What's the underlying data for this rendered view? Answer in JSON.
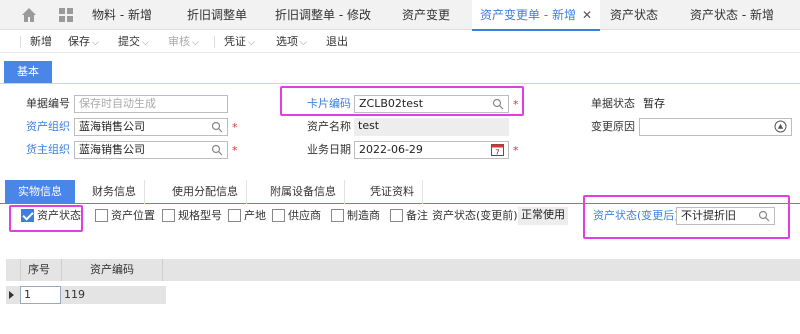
{
  "tabs": [
    {
      "label": "物料 - 新增"
    },
    {
      "label": "折旧调整单"
    },
    {
      "label": "折旧调整单 - 修改"
    },
    {
      "label": "资产变更"
    },
    {
      "label": "资产变更单 - 新增",
      "active": true,
      "close": "✕"
    },
    {
      "label": "资产状态"
    },
    {
      "label": "资产状态 - 新增"
    }
  ],
  "toolbar": {
    "new": "新增",
    "save": "保存",
    "submit": "提交",
    "audit": "审核",
    "voucher": "凭证",
    "options": "选项",
    "exit": "退出"
  },
  "section": {
    "basic": "基本"
  },
  "form": {
    "doc_no_label": "单据编号",
    "doc_no_placeholder": "保存时自动生成",
    "asset_org_label": "资产组织",
    "asset_org_value": "蓝海销售公司",
    "owner_org_label": "货主组织",
    "owner_org_value": "蓝海销售公司",
    "card_no_label": "卡片编码",
    "card_no_value": "ZCLB02test",
    "asset_name_label": "资产名称",
    "asset_name_value": "test",
    "biz_date_label": "业务日期",
    "biz_date_value": "2022-06-29",
    "doc_status_label": "单据状态",
    "doc_status_value": "暂存",
    "change_reason_label": "变更原因",
    "change_reason_value": "",
    "required_mark": "*"
  },
  "subtabs": [
    "实物信息",
    "财务信息",
    "使用分配信息",
    "附属设备信息",
    "凭证资料"
  ],
  "checks": [
    {
      "label": "资产状态",
      "checked": true
    },
    {
      "label": "资产位置",
      "checked": false
    },
    {
      "label": "规格型号",
      "checked": false
    },
    {
      "label": "产地",
      "checked": false
    },
    {
      "label": "供应商",
      "checked": false
    },
    {
      "label": "制造商",
      "checked": false
    },
    {
      "label": "备注",
      "checked": false
    }
  ],
  "status_before_label": "资产状态(变更前)",
  "status_before_value": "正常使用",
  "status_after_label": "资产状态(变更后)",
  "status_after_value": "不计提折旧",
  "grid": {
    "headers": [
      "序号",
      "资产编码"
    ],
    "rows": [
      {
        "seq": "1",
        "code": "119"
      }
    ]
  },
  "colors": {
    "accent": "#3d7fe0",
    "highlight": "#e23fe0",
    "required": "#e03030"
  },
  "icons": [
    "home-icon",
    "grid-apps-icon",
    "search-icon",
    "calendar-icon",
    "clear-icon",
    "expand-row-icon"
  ]
}
